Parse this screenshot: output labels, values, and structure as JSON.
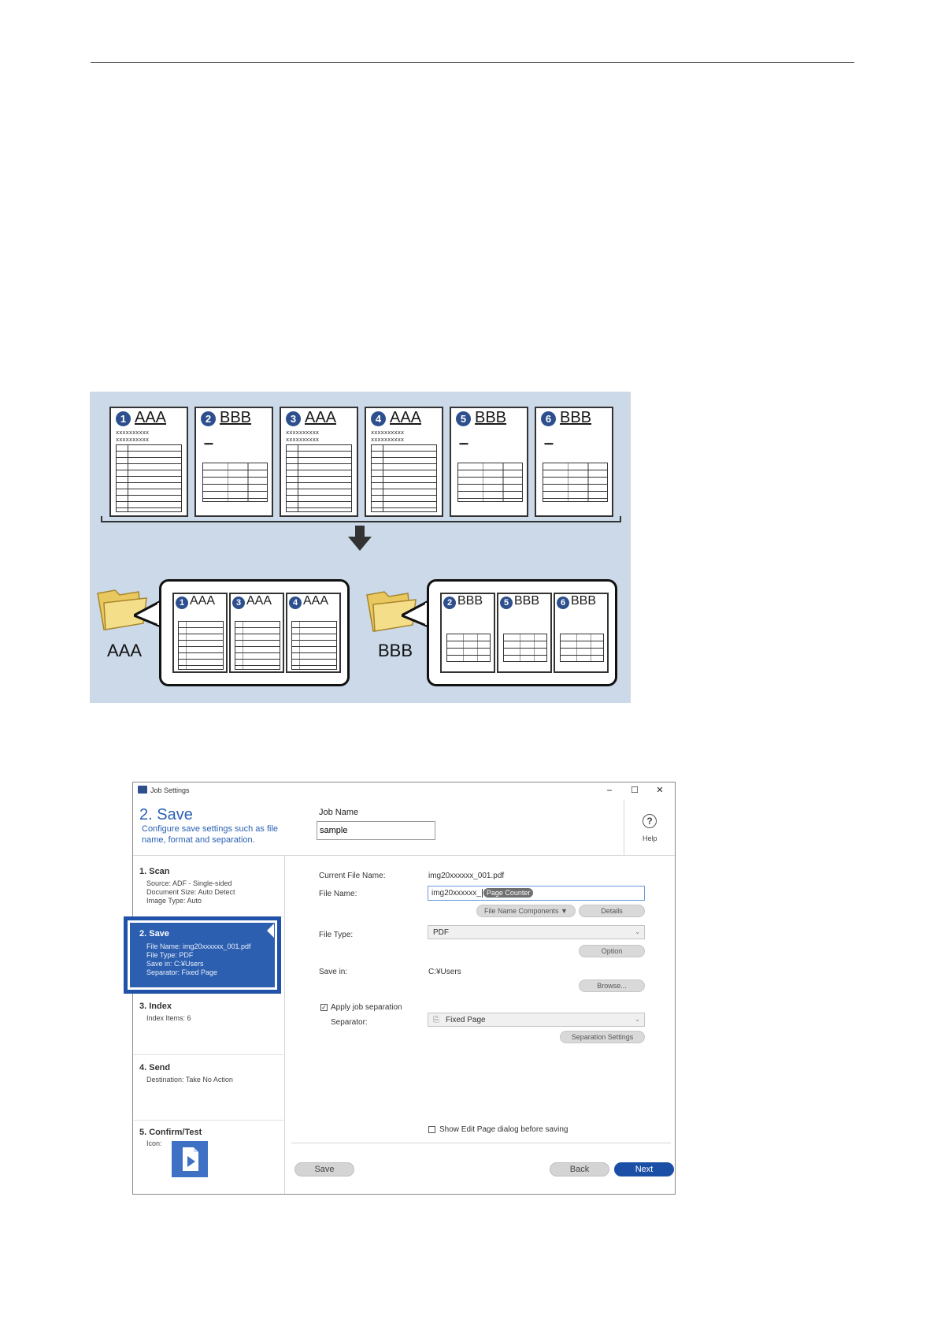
{
  "diagram": {
    "top_pages": [
      {
        "num": "1",
        "title": "AAA",
        "xline": "xxxxxxxxxx",
        "kind": "tall"
      },
      {
        "num": "2",
        "title": "BBB",
        "dots": "▪▪▪▪▪",
        "kind": "short"
      },
      {
        "num": "3",
        "title": "AAA",
        "xline": "xxxxxxxxxx",
        "kind": "tall"
      },
      {
        "num": "4",
        "title": "AAA",
        "xline": "xxxxxxxxxx",
        "kind": "tall"
      },
      {
        "num": "5",
        "title": "BBB",
        "dots": "▪▪▪▪▪",
        "kind": "short"
      },
      {
        "num": "6",
        "title": "BBB",
        "dots": "▪▪▪▪▪",
        "kind": "short"
      }
    ],
    "groups": [
      {
        "folder_label": "AAA",
        "pages": [
          {
            "num": "1",
            "title": "AAA"
          },
          {
            "num": "3",
            "title": "AAA"
          },
          {
            "num": "4",
            "title": "AAA"
          }
        ]
      },
      {
        "folder_label": "BBB",
        "pages": [
          {
            "num": "2",
            "title": "BBB"
          },
          {
            "num": "5",
            "title": "BBB"
          },
          {
            "num": "6",
            "title": "BBB"
          }
        ]
      }
    ],
    "colors": {
      "background": "#cbd9e9",
      "badge": "#2d4f8e",
      "folder": "#f2d77a"
    }
  },
  "window": {
    "title": "Job Settings",
    "controls": {
      "minimize": "−",
      "maximize": "☐",
      "close": "✕"
    },
    "header": {
      "step_title": "2. Save",
      "step_desc": "Configure save settings such as file name, format and separation.",
      "job_name_label": "Job Name",
      "job_name_value": "sample",
      "help_label": "Help"
    },
    "sidebar": {
      "scan": {
        "title": "1. Scan",
        "lines": [
          "Source: ADF - Single-sided",
          "Document Size: Auto Detect",
          "Image Type: Auto"
        ]
      },
      "save": {
        "title": "2. Save",
        "lines": [
          "File Name: img20xxxxxx_001.pdf",
          "File Type: PDF",
          "Save in: C:¥Users",
          "Separator: Fixed Page"
        ]
      },
      "index": {
        "title": "3. Index",
        "lines": [
          "Index Items: 6"
        ]
      },
      "send": {
        "title": "4. Send",
        "lines": [
          "Destination: Take No Action"
        ]
      },
      "confirm": {
        "title": "5. Confirm/Test",
        "icon_label": "Icon:"
      }
    },
    "main": {
      "current_file_name_label": "Current File Name:",
      "current_file_name_value": "img20xxxxxx_001.pdf",
      "file_name_label": "File Name:",
      "file_name_value": "img20xxxxxx_",
      "file_name_token": "Page Counter",
      "file_name_components_btn": "File Name Components ▼",
      "details_btn": "Details",
      "file_type_label": "File Type:",
      "file_type_value": "PDF",
      "option_btn": "Option",
      "save_in_label": "Save in:",
      "save_in_value": "C:¥Users",
      "browse_btn": "Browse...",
      "apply_separation_label": "Apply job separation",
      "apply_separation_checked": true,
      "separator_label": "Separator:",
      "separator_value": "Fixed Page",
      "separation_settings_btn": "Separation Settings",
      "show_edit_page_label": "Show Edit Page dialog before saving",
      "show_edit_page_checked": false
    },
    "footer": {
      "save_btn": "Save",
      "back_btn": "Back",
      "next_btn": "Next"
    },
    "colors": {
      "accent": "#2a61b4",
      "active_step": "#2c5fb0",
      "next_button": "#1b4fa6"
    }
  }
}
